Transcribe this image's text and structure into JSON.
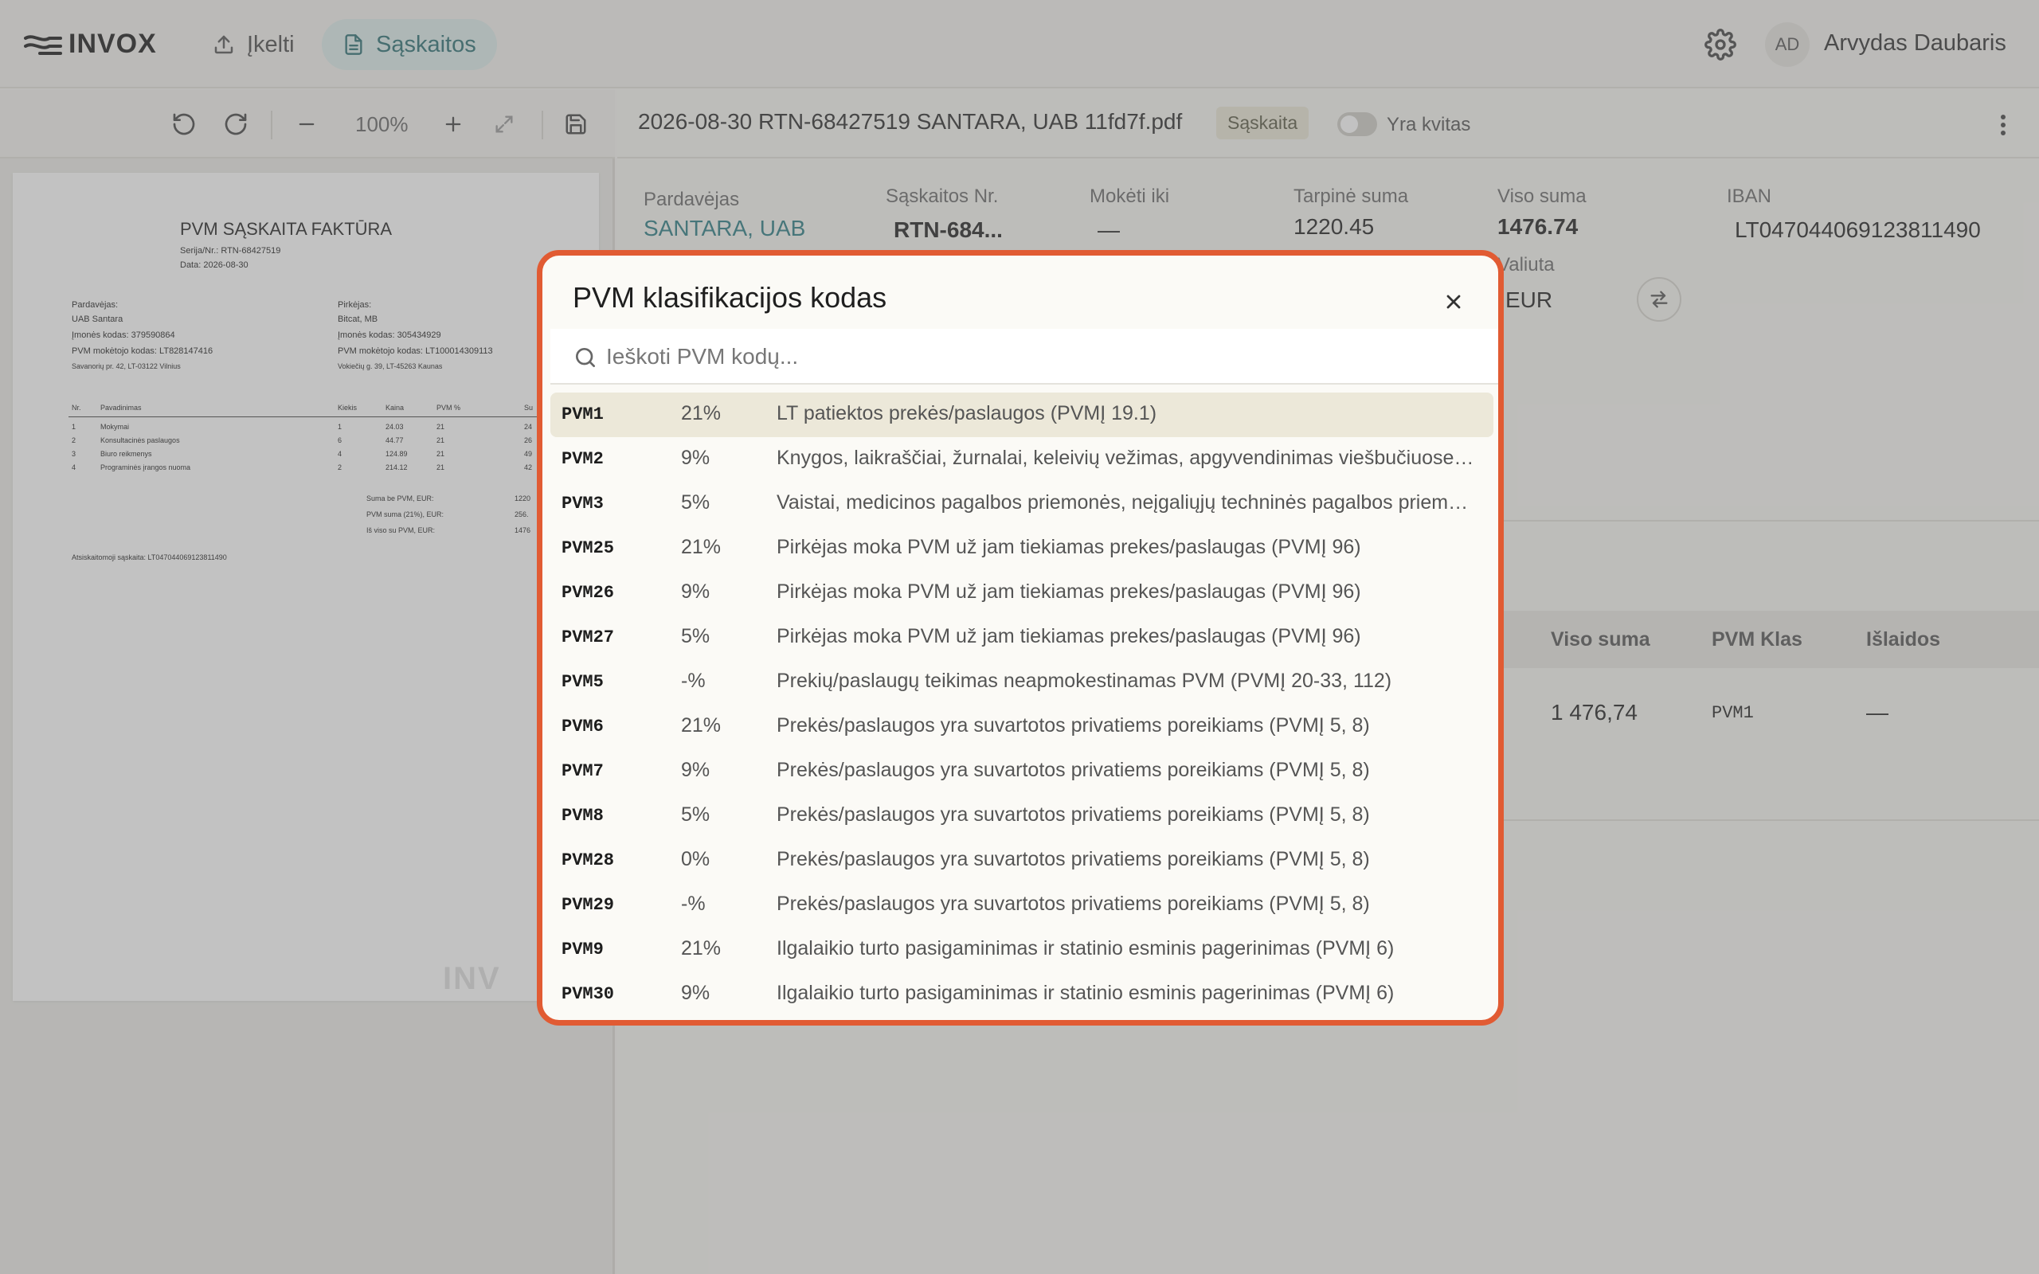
{
  "app": {
    "logo": "INVOX",
    "nav": [
      {
        "label": "Įkelti",
        "icon": "upload-icon"
      },
      {
        "label": "Sąskaitos",
        "icon": "document-icon",
        "active": true
      }
    ],
    "user": {
      "initials": "AD",
      "name": "Arvydas Daubaris"
    }
  },
  "pdf_toolbar": {
    "zoom": "100%"
  },
  "pdf_preview": {
    "title": "PVM SĄSKAITA FAKTŪRA",
    "series_line": "Serija/Nr.: RTN-68427519",
    "date_line": "Data: 2026-08-30",
    "seller_label": "Pardavėjas:",
    "seller_name": "UAB Santara",
    "seller_code": "Įmonės kodas: 379590864",
    "seller_vat": "PVM mokėtojo kodas: LT828147416",
    "seller_address": "Savanorių pr. 42, LT-03122 Vilnius",
    "buyer_label": "Pirkėjas:",
    "buyer_name": "Bitcat, MB",
    "buyer_code": "Įmonės kodas: 305434929",
    "buyer_vat": "PVM mokėtojo kodas: LT100014309113",
    "buyer_address": "Vokiečių g. 39, LT-45263 Kaunas",
    "table_headers": [
      "Nr.",
      "Pavadinimas",
      "Kiekis",
      "Kaina",
      "PVM %",
      "Su"
    ],
    "rows": [
      [
        "1",
        "Mokymai",
        "1",
        "24.03",
        "21",
        "24"
      ],
      [
        "2",
        "Konsultacinės paslaugos",
        "6",
        "44.77",
        "21",
        "26"
      ],
      [
        "3",
        "Biuro reikmenys",
        "4",
        "124.89",
        "21",
        "49"
      ],
      [
        "4",
        "Programinės įrangos nuoma",
        "2",
        "214.12",
        "21",
        "42"
      ]
    ],
    "total_labels": [
      "Suma be PVM, EUR:",
      "PVM suma (21%), EUR:",
      "Iš viso su PVM, EUR:"
    ],
    "total_values": [
      "1220",
      "256.",
      "1476"
    ],
    "account_line": "Atsiskaitomoji sąskaita: LT047044069123811490",
    "watermark": "INV"
  },
  "document": {
    "filename": "2026-08-30 RTN-68427519 SANTARA, UAB 11fd7f.pdf",
    "type_tag": "Sąskaita",
    "receipt_toggle_label": "Yra kvitas",
    "fields": {
      "seller_label": "Pardavėjas",
      "seller_value": "SANTARA, UAB",
      "invoice_no_label": "Sąskaitos Nr.",
      "invoice_no_value": "RTN-684...",
      "due_label": "Mokėti iki",
      "due_value": "—",
      "subtotal_label": "Tarpinė suma",
      "subtotal_value": "1220.45",
      "total_label": "Viso suma",
      "total_value": "1476.74",
      "currency_label": "Valiuta",
      "currency_value": "EUR",
      "iban_label": "IBAN",
      "iban_value": "LT047044069123811490"
    },
    "lines_table": {
      "headers": [
        "Viso suma",
        "PVM Klas",
        "Išlaidos"
      ],
      "row": [
        "1 476,74",
        "PVM1",
        "—"
      ]
    }
  },
  "modal": {
    "title": "PVM klasifikacijos kodas",
    "search_placeholder": "Ieškoti PVM kodų...",
    "codes": [
      {
        "code": "PVM1",
        "rate": "21%",
        "desc": "LT patiektos prekės/paslaugos (PVMĮ 19.1)",
        "active": true
      },
      {
        "code": "PVM2",
        "rate": "9%",
        "desc": "Knygos, laikraščiai, žurnalai, keleivių vežimas, apgyvendinimas viešbučiuose, ir ..."
      },
      {
        "code": "PVM3",
        "rate": "5%",
        "desc": "Vaistai, medicinos pagalbos priemonės, neįgaliųjų techninės pagalbos priemon..."
      },
      {
        "code": "PVM25",
        "rate": "21%",
        "desc": "Pirkėjas moka PVM už jam tiekiamas prekes/paslaugas (PVMĮ 96)"
      },
      {
        "code": "PVM26",
        "rate": "9%",
        "desc": "Pirkėjas moka PVM už jam tiekiamas prekes/paslaugas (PVMĮ 96)"
      },
      {
        "code": "PVM27",
        "rate": "5%",
        "desc": "Pirkėjas moka PVM už jam tiekiamas prekes/paslaugas (PVMĮ 96)"
      },
      {
        "code": "PVM5",
        "rate": "-%",
        "desc": "Prekių/paslaugų teikimas neapmokestinamas PVM (PVMĮ 20-33, 112)"
      },
      {
        "code": "PVM6",
        "rate": "21%",
        "desc": "Prekės/paslaugos yra suvartotos privatiems poreikiams (PVMĮ 5, 8)"
      },
      {
        "code": "PVM7",
        "rate": "9%",
        "desc": "Prekės/paslaugos yra suvartotos privatiems poreikiams (PVMĮ 5, 8)"
      },
      {
        "code": "PVM8",
        "rate": "5%",
        "desc": "Prekės/paslaugos yra suvartotos privatiems poreikiams (PVMĮ 5, 8)"
      },
      {
        "code": "PVM28",
        "rate": "0%",
        "desc": "Prekės/paslaugos yra suvartotos privatiems poreikiams (PVMĮ 5, 8)"
      },
      {
        "code": "PVM29",
        "rate": "-%",
        "desc": "Prekės/paslaugos yra suvartotos privatiems poreikiams (PVMĮ 5, 8)"
      },
      {
        "code": "PVM9",
        "rate": "21%",
        "desc": "Ilgalaikio turto pasigaminimas ir statinio esminis pagerinimas (PVMĮ 6)"
      },
      {
        "code": "PVM30",
        "rate": "9%",
        "desc": "Ilgalaikio turto pasigaminimas ir statinio esminis pagerinimas (PVMĮ 6)"
      }
    ]
  },
  "colors": {
    "accent": "#2b7d83",
    "modal_border": "#e15b33",
    "active_row": "#ece8d9"
  }
}
